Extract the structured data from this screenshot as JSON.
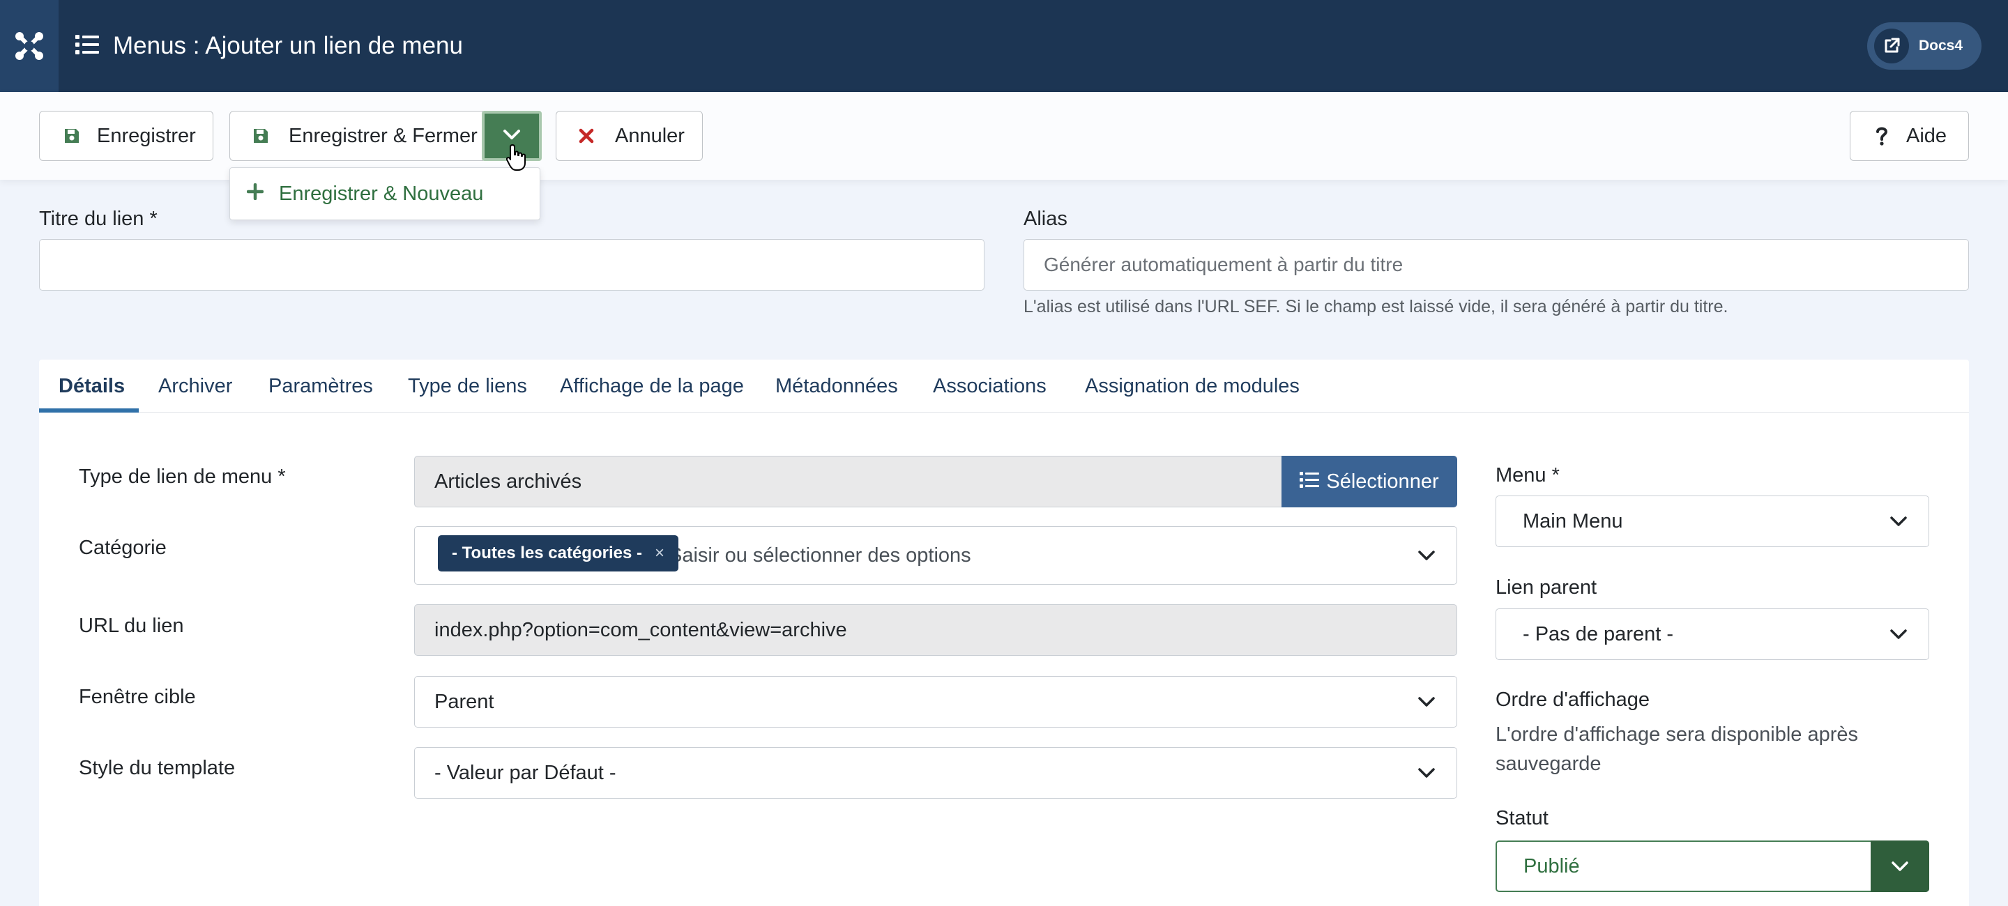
{
  "header": {
    "title": "Menus : Ajouter un lien de menu",
    "docs_label": "Docs4"
  },
  "toolbar": {
    "save_label": "Enregistrer",
    "save_close_label": "Enregistrer & Fermer",
    "cancel_label": "Annuler",
    "help_label": "Aide",
    "dropdown_item_label": "Enregistrer & Nouveau"
  },
  "form": {
    "title_label": "Titre du lien *",
    "title_value": "",
    "alias_label": "Alias",
    "alias_placeholder": "Générer automatiquement à partir du titre",
    "alias_hint": "L'alias est utilisé dans l'URL SEF. Si le champ est laissé vide, il sera généré à partir du titre."
  },
  "tabs": [
    "Détails",
    "Archiver",
    "Paramètres",
    "Type de liens",
    "Affichage de la page",
    "Métadonnées",
    "Associations",
    "Assignation de modules"
  ],
  "details": {
    "menu_item_type_label": "Type de lien de menu *",
    "menu_item_type_value": "Articles archivés",
    "select_button_label": "Sélectionner",
    "category_label": "Catégorie",
    "category_chip": "- Toutes les catégories -",
    "category_chip_remove": "×",
    "category_placeholder": "Saisir ou sélectionner des options",
    "link_label": "URL du lien",
    "link_value": "index.php?option=com_content&view=archive",
    "target_label": "Fenêtre cible",
    "target_value": "Parent",
    "template_label": "Style du template",
    "template_value": "- Valeur par Défaut -"
  },
  "sidebar": {
    "menu_label": "Menu *",
    "menu_value": "Main Menu",
    "parent_label": "Lien parent",
    "parent_value": "- Pas de parent -",
    "ordering_label": "Ordre d'affichage",
    "ordering_text": "L'ordre d'affichage sera disponible après sauvegarde",
    "status_label": "Statut",
    "status_value": "Publié"
  },
  "colors": {
    "header_bg": "#1c3553",
    "primary": "#3a6394",
    "success": "#457d54",
    "danger": "#c52827"
  },
  "icons": [
    "joomla-logo-icon",
    "list-icon",
    "external-link-icon",
    "save-icon",
    "chevron-down-icon",
    "close-x-icon",
    "question-icon",
    "plus-icon",
    "cursor-hand-icon"
  ]
}
